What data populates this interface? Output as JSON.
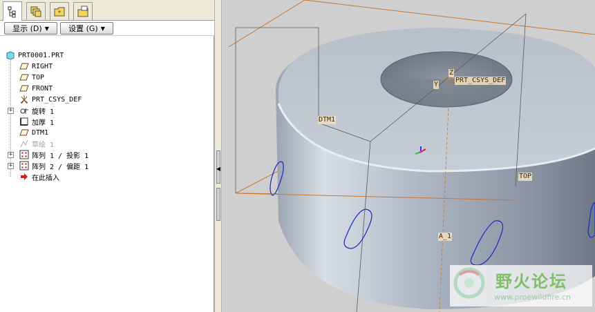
{
  "tabs": [
    {
      "icon": "model-tree-icon"
    },
    {
      "icon": "layers-icon"
    },
    {
      "icon": "folder-browser-icon"
    },
    {
      "icon": "favorites-icon"
    }
  ],
  "toolbar": {
    "show_label": "显示 (D)",
    "settings_label": "设置 (G)"
  },
  "tree": {
    "root": "PRT0001.PRT",
    "items": [
      {
        "label": "RIGHT",
        "icon": "datum-plane-icon"
      },
      {
        "label": "TOP",
        "icon": "datum-plane-icon"
      },
      {
        "label": "FRONT",
        "icon": "datum-plane-icon"
      },
      {
        "label": "PRT_CSYS_DEF",
        "icon": "coordinate-system-icon"
      },
      {
        "label": "旋转 1",
        "icon": "revolve-icon",
        "expandable": true
      },
      {
        "label": "加厚 1",
        "icon": "thicken-icon"
      },
      {
        "label": "DTM1",
        "icon": "datum-plane-icon"
      },
      {
        "label": "草绘 1",
        "icon": "sketch-icon",
        "suppressed": true
      },
      {
        "label": "阵列 1 / 投影 1",
        "icon": "pattern-icon",
        "expandable": true
      },
      {
        "label": "阵列 2 / 偏距 1",
        "icon": "pattern-icon",
        "expandable": true
      },
      {
        "label": "在此插入",
        "icon": "insert-here-arrow-icon"
      }
    ]
  },
  "viewport": {
    "labels": {
      "csys": "PRT_CSYS_DEF",
      "dtm1": "DTM1",
      "top": "TOP",
      "axis": "A_1",
      "z": "Z",
      "y": "Y"
    },
    "colors": {
      "background": "#cfcfcf",
      "datum_line": "#c8782a",
      "edge_line": "#6a6a6a",
      "sketch_curve": "#2030c0"
    }
  },
  "watermark": {
    "title": "野火论坛",
    "url": "www.proewildfire.cn"
  }
}
